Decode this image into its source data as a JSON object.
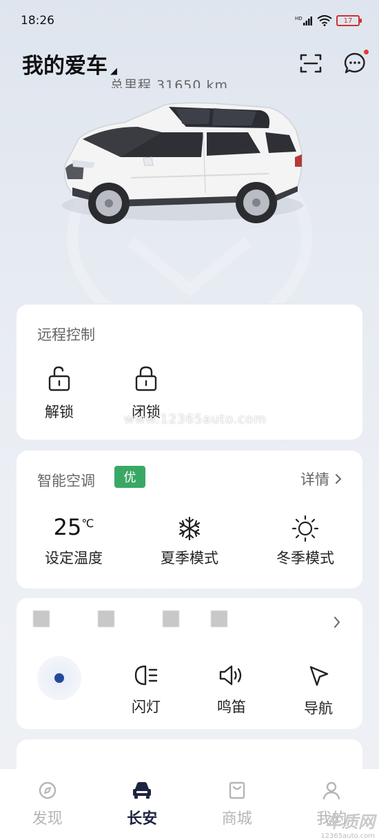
{
  "status": {
    "time": "18:26",
    "battery_level": "17",
    "network_label": "HD"
  },
  "header": {
    "title": "我的爱车",
    "caret": "◢",
    "scan_icon": "scan-icon",
    "message_icon": "message-icon"
  },
  "vehicle": {
    "mileage_text": "总里程 31650 km",
    "color": "#f4f4f4"
  },
  "remote_control": {
    "title": "远程控制",
    "items": [
      {
        "label": "解锁",
        "icon": "unlock-icon"
      },
      {
        "label": "闭锁",
        "icon": "lock-icon"
      }
    ]
  },
  "smart_ac": {
    "title": "智能空调",
    "badge": "优",
    "detail_label": "详情",
    "items": [
      {
        "value": "25",
        "unit": "℃",
        "label": "设定温度"
      },
      {
        "icon": "snowflake-icon",
        "label": "夏季模式"
      },
      {
        "icon": "sun-icon",
        "label": "冬季模式"
      }
    ]
  },
  "quick_actions": {
    "items": [
      {
        "label": "闪灯",
        "icon": "headlight-icon"
      },
      {
        "label": "鸣笛",
        "icon": "horn-icon"
      },
      {
        "label": "导航",
        "icon": "navigation-icon"
      }
    ]
  },
  "watermark": "www.12365auto.com",
  "tabbar": {
    "items": [
      {
        "label": "发现",
        "icon": "discover-icon",
        "active": false
      },
      {
        "label": "长安",
        "icon": "car-icon",
        "active": true
      },
      {
        "label": "商城",
        "icon": "shop-icon",
        "active": false
      },
      {
        "label": "我的",
        "icon": "profile-icon",
        "active": false
      }
    ]
  },
  "corner_logo": {
    "text": "车质网",
    "url": "12365auto.com"
  },
  "colors": {
    "accent_green": "#3aa865",
    "active_tab": "#1c2440",
    "badge_red": "#e53935"
  }
}
